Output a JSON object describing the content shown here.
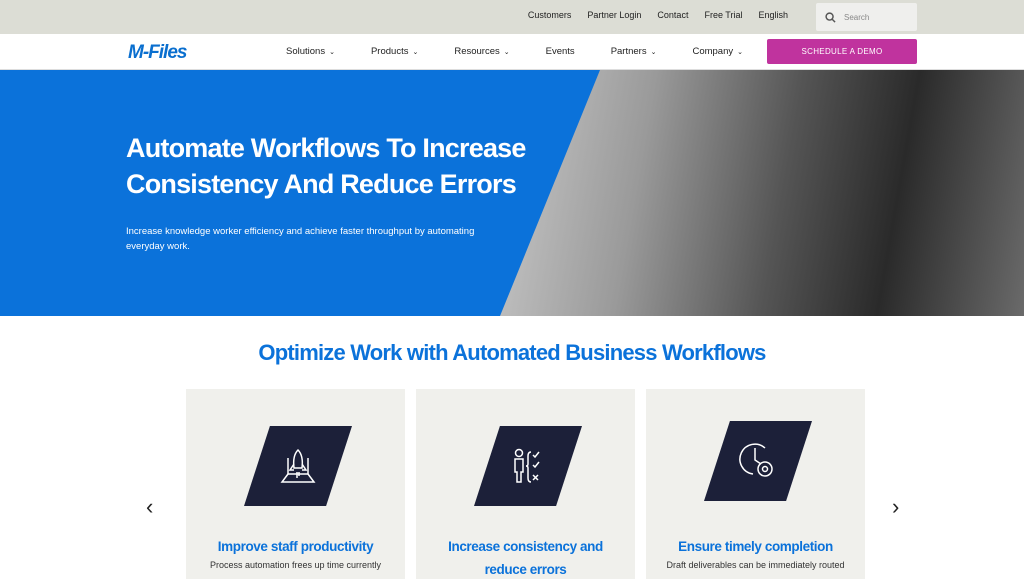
{
  "topbar": {
    "links": [
      "Customers",
      "Partner Login",
      "Contact",
      "Free Trial",
      "English"
    ],
    "search_placeholder": "Search"
  },
  "nav": {
    "logo": "M-Files",
    "items": [
      "Solutions",
      "Products",
      "Resources",
      "Events",
      "Partners",
      "Company"
    ],
    "cta": "SCHEDULE A DEMO"
  },
  "hero": {
    "title": "Automate Workflows To Increase Consistency And Reduce Errors",
    "subtitle": "Increase knowledge worker efficiency and achieve faster throughput by automating everyday work."
  },
  "section": {
    "title": "Optimize Work with Automated Business Workflows",
    "cards": [
      {
        "title": "Improve staff productivity",
        "text": "Process automation frees up time currently",
        "icon": "rocket-laptop-icon"
      },
      {
        "title": "Increase consistency and reduce errors",
        "text": "",
        "icon": "person-checklist-icon"
      },
      {
        "title": "Ensure timely completion",
        "text": "Draft deliverables can be immediately routed",
        "icon": "clock-gear-icon"
      }
    ]
  },
  "colors": {
    "brand_blue": "#0b72da",
    "cta_magenta": "#c0339e",
    "icon_bg": "#1c2039"
  }
}
